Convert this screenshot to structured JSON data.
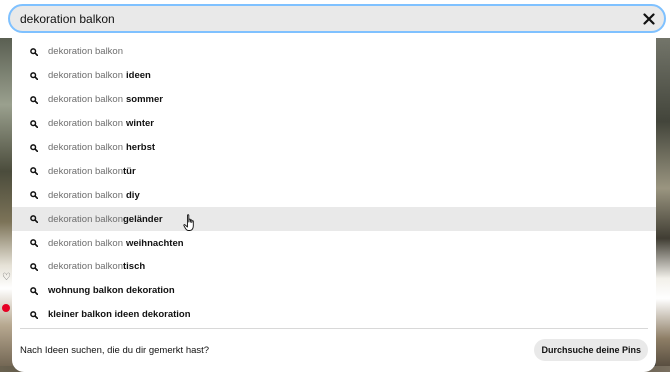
{
  "search": {
    "query": "dekoration balkon",
    "clear_icon": "close-icon"
  },
  "suggestions": [
    {
      "prefix": "dekoration balkon",
      "suffix": "",
      "space": false,
      "highlighted": false
    },
    {
      "prefix": "dekoration balkon",
      "suffix": "ideen",
      "space": true,
      "highlighted": false
    },
    {
      "prefix": "dekoration balkon",
      "suffix": "sommer",
      "space": true,
      "highlighted": false
    },
    {
      "prefix": "dekoration balkon",
      "suffix": "winter",
      "space": true,
      "highlighted": false
    },
    {
      "prefix": "dekoration balkon",
      "suffix": "herbst",
      "space": true,
      "highlighted": false
    },
    {
      "prefix": "dekoration balkon",
      "suffix": "tür",
      "space": false,
      "highlighted": false
    },
    {
      "prefix": "dekoration balkon",
      "suffix": "diy",
      "space": true,
      "highlighted": false
    },
    {
      "prefix": "dekoration balkon",
      "suffix": "geländer",
      "space": false,
      "highlighted": true
    },
    {
      "prefix": "dekoration balkon",
      "suffix": "weihnachten",
      "space": true,
      "highlighted": false
    },
    {
      "prefix": "dekoration balkon",
      "suffix": "tisch",
      "space": false,
      "highlighted": false
    },
    {
      "prefix": "",
      "suffix": "wohnung balkon dekoration",
      "space": false,
      "highlighted": false
    },
    {
      "prefix": "",
      "suffix": "kleiner balkon ideen dekoration",
      "space": false,
      "highlighted": false
    }
  ],
  "footer": {
    "text": "Nach Ideen suchen, die du dir gemerkt hast?",
    "button_label": "Durchsuche deine Pins"
  },
  "colors": {
    "focus_ring": "#7fc1ff",
    "highlight_row": "#e9e9e9",
    "brand_red": "#e60023"
  }
}
